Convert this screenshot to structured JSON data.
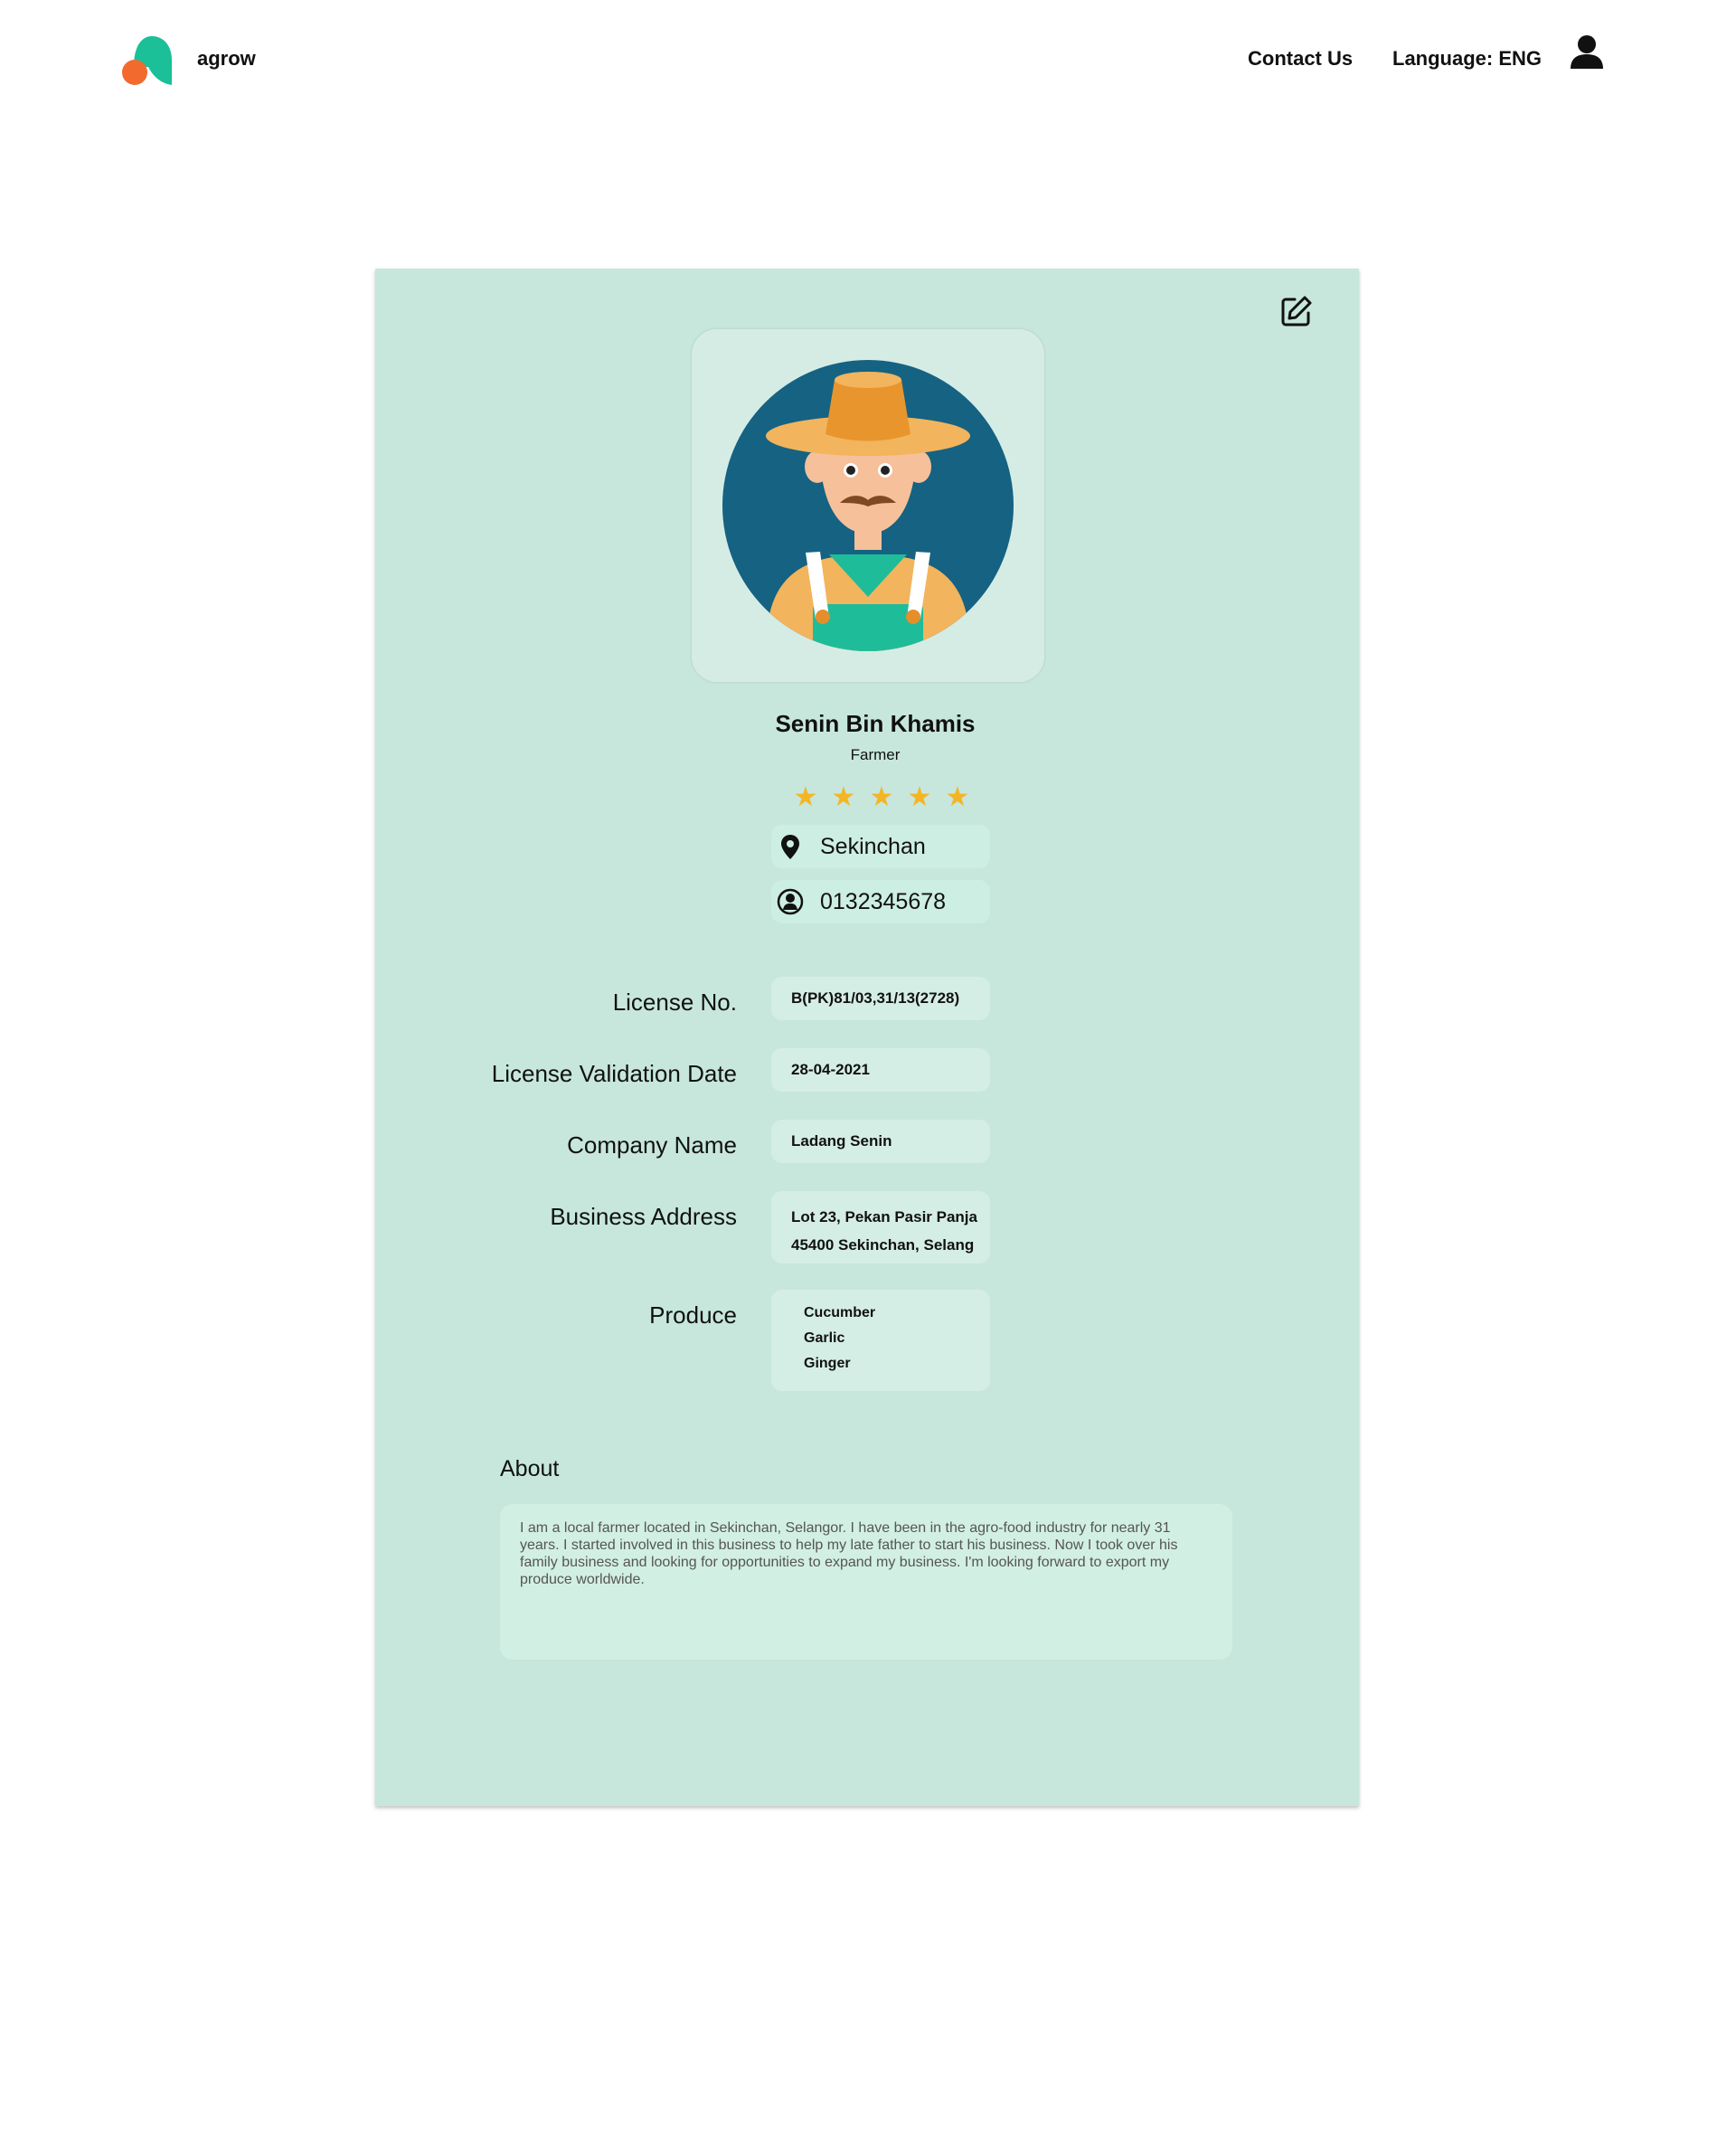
{
  "header": {
    "brand": "agrow",
    "contact": "Contact Us",
    "language": "Language: ENG"
  },
  "profile": {
    "name": "Senin Bin Khamis",
    "role": "Farmer",
    "rating": 5,
    "rating_max": 5,
    "location": "Sekinchan",
    "phone": "0132345678"
  },
  "details": {
    "license_label": "License No.",
    "license_value": "B(PK)81/03,31/13(2728)",
    "validation_label": "License Validation Date",
    "validation_value": "28-04-2021",
    "company_label": "Company Name",
    "company_value": "Ladang Senin",
    "address_label": "Business Address",
    "address_line1": "Lot 23, Pekan Pasir Panja",
    "address_line2": "45400 Sekinchan, Selang",
    "produce_label": "Produce",
    "produce": [
      "Cucumber",
      "Garlic",
      "Ginger"
    ]
  },
  "about": {
    "title": "About",
    "text": "I am a local farmer located in Sekinchan, Selangor. I have been in the agro-food industry for nearly 31 years. I started involved in this business to help my late father to start his business. Now I took over his family business and looking for opportunities to expand my business. I'm looking forward to export my produce worldwide."
  },
  "colors": {
    "card_bg": "#c7e7dc",
    "star": "#f4b524",
    "logo_green": "#1bbf98",
    "logo_orange": "#f26a2e"
  },
  "icons": [
    "logo-icon",
    "user-icon",
    "edit-icon",
    "star-icon",
    "location-pin-icon",
    "contact-person-icon"
  ]
}
